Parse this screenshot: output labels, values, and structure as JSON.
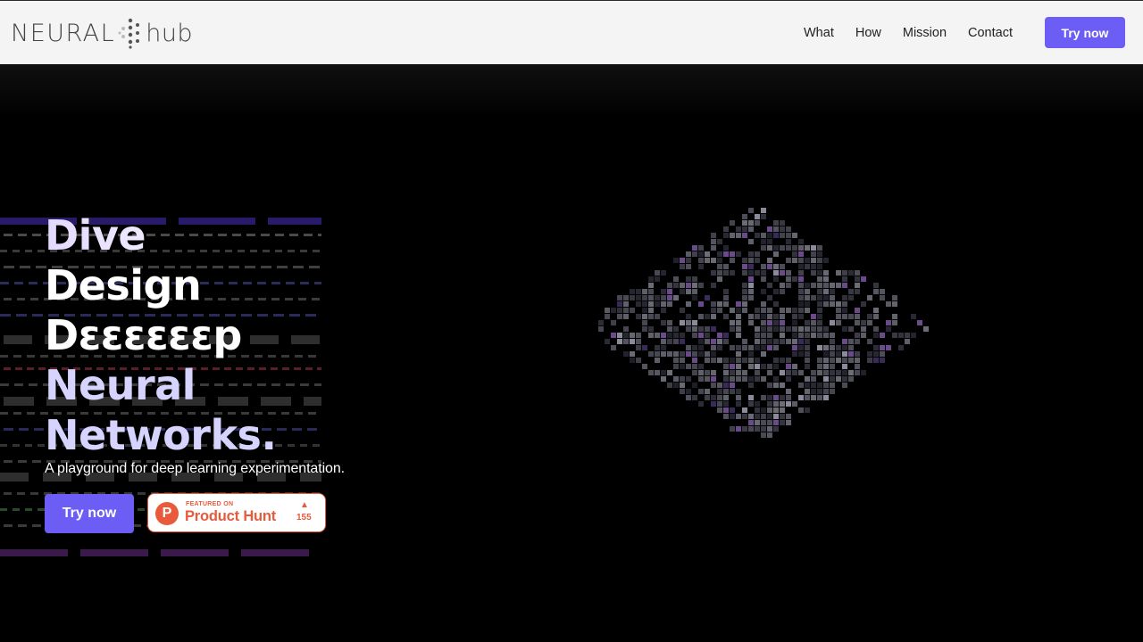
{
  "header": {
    "logo_left": "NEURAL",
    "logo_right": "hub",
    "nav": [
      "What",
      "How",
      "Mission",
      "Contact"
    ],
    "cta_label": "Try now"
  },
  "hero": {
    "headline": [
      "Dive",
      "Design",
      "Dεεεεεεp",
      "Neural",
      "Networks."
    ],
    "tagline": "A playground for deep learning experimentation.",
    "cta_label": "Try now",
    "product_hunt": {
      "small": "FEATURED ON",
      "big": "Product Hunt",
      "count": "155"
    }
  },
  "colors": {
    "accent": "#6c5df4",
    "headline_lavender": "#d7d3ff",
    "product_hunt": "#e95a3c",
    "header_bg": "#f4f4f4",
    "hero_bg": "#000000"
  },
  "icons": [
    "neuralhub-logo-mark",
    "product-hunt-logo",
    "upvote-arrow-icon"
  ]
}
